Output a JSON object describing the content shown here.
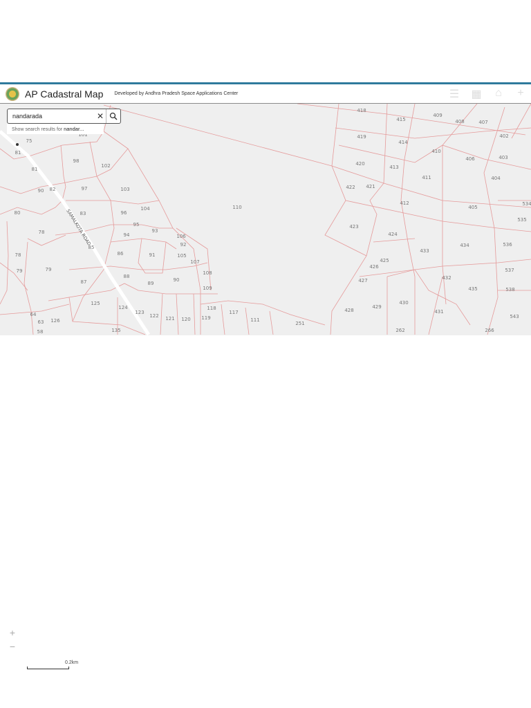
{
  "header": {
    "title": "AP Cadastral Map",
    "subtitle": "Developed by Andhra Pradesh Space Applications Center",
    "icons": [
      "list-icon",
      "layers-icon",
      "home-icon",
      "add-icon"
    ]
  },
  "search": {
    "value": "nandarada",
    "suggestion_prefix": "Show search results for ",
    "suggestion_term": "nandar..."
  },
  "map": {
    "road_label": "SAMALKOTA ROAD",
    "parcels": [
      "75",
      "81",
      "81",
      "98",
      "102",
      "101",
      "90",
      "82",
      "97",
      "103",
      "80",
      "83",
      "96",
      "104",
      "95",
      "78",
      "94",
      "93",
      "106",
      "92",
      "78",
      "86",
      "91",
      "105",
      "107",
      "79",
      "79",
      "87",
      "88",
      "89",
      "90",
      "108",
      "109",
      "125",
      "124",
      "123",
      "122",
      "121",
      "120",
      "118",
      "119",
      "117",
      "111",
      "251",
      "64",
      "63",
      "126",
      "58",
      "135",
      "110",
      "85",
      "418",
      "415",
      "409",
      "408",
      "407",
      "402",
      "419",
      "414",
      "410",
      "406",
      "403",
      "420",
      "413",
      "411",
      "404",
      "422",
      "421",
      "412",
      "405",
      "534",
      "535",
      "423",
      "424",
      "433",
      "434",
      "536",
      "425",
      "426",
      "427",
      "432",
      "435",
      "537",
      "538",
      "428",
      "429",
      "430",
      "431",
      "543",
      "262",
      "266"
    ]
  },
  "controls": {
    "zoom_in": "+",
    "zoom_out": "−",
    "scale": "0.2km"
  }
}
